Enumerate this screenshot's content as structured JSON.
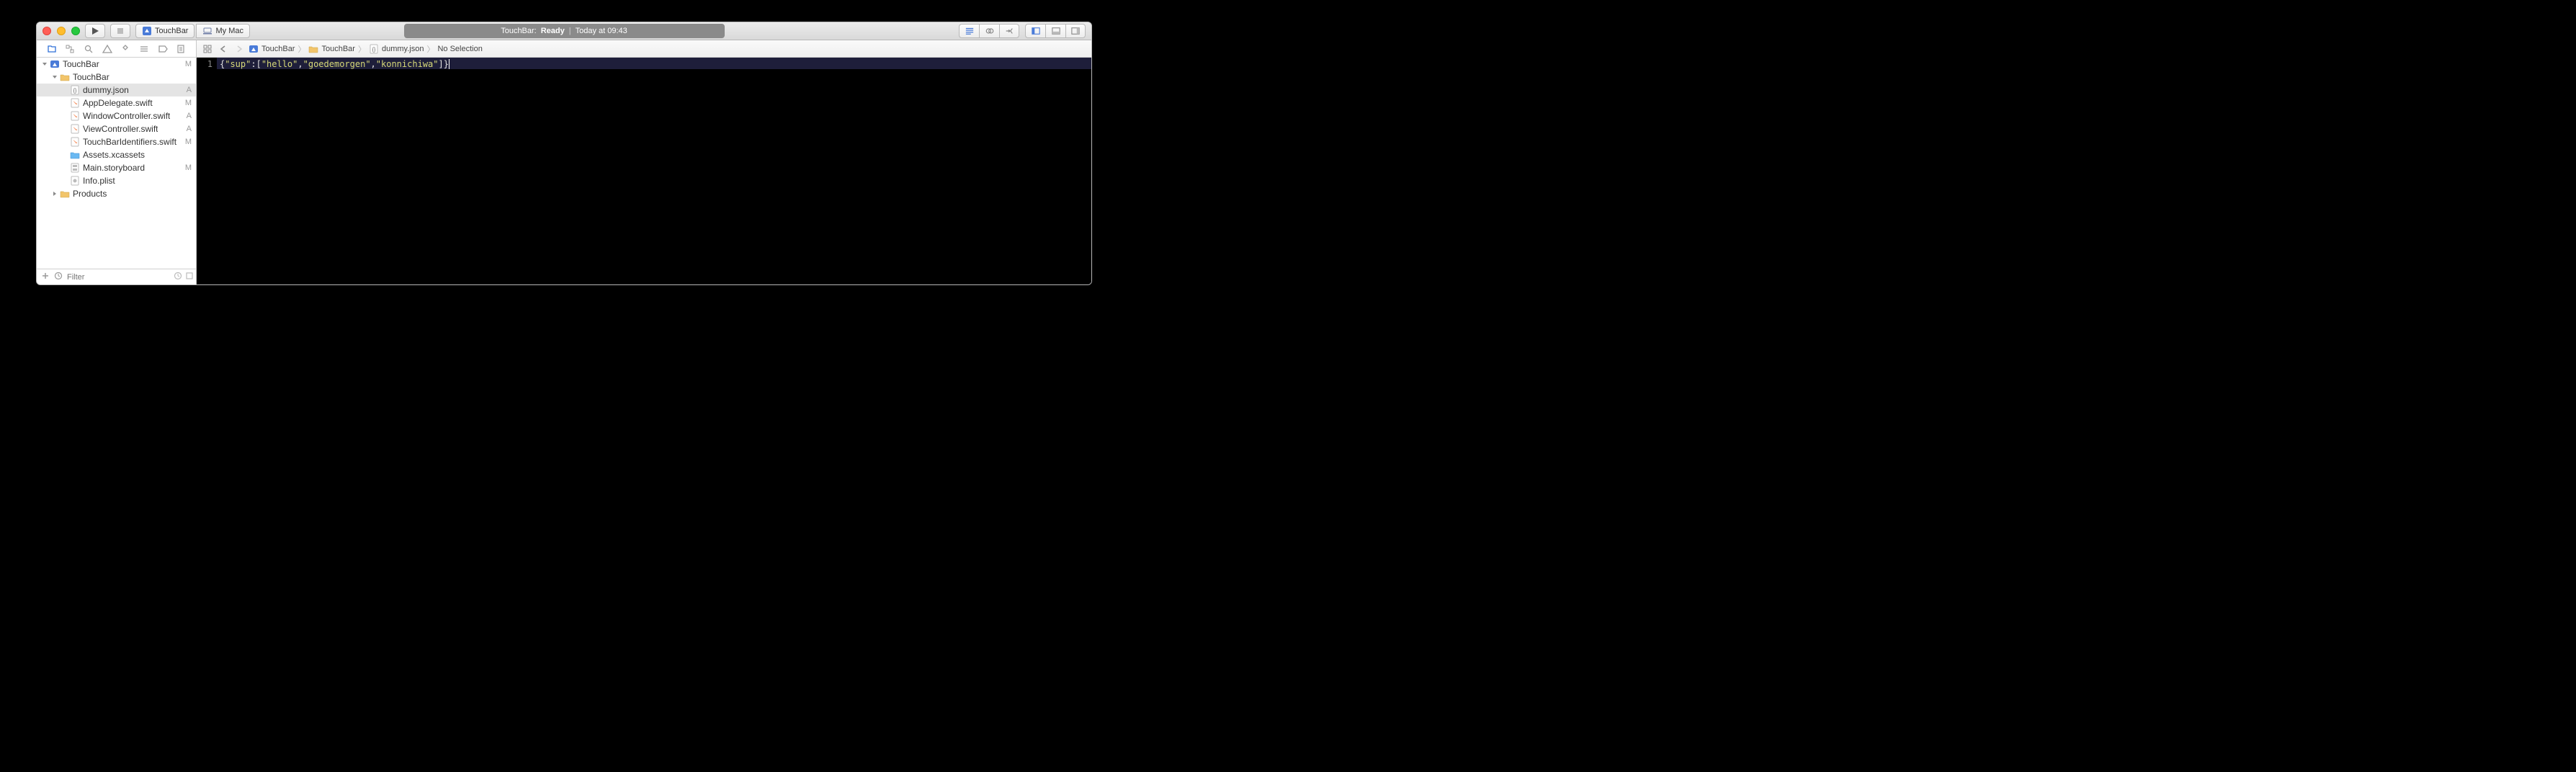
{
  "window": {
    "scheme_target": "TouchBar",
    "scheme_destination": "My Mac",
    "activity_prefix": "TouchBar:",
    "activity_status": "Ready",
    "activity_time": "Today at 09:43"
  },
  "navigator": {
    "filter_placeholder": "Filter",
    "tree": [
      {
        "label": "TouchBar",
        "kind": "proj",
        "depth": 0,
        "disclosure": "open",
        "badge": "M"
      },
      {
        "label": "TouchBar",
        "kind": "folder",
        "depth": 1,
        "disclosure": "open",
        "badge": ""
      },
      {
        "label": "dummy.json",
        "kind": "json",
        "depth": 2,
        "disclosure": "none",
        "badge": "A",
        "selected": true
      },
      {
        "label": "AppDelegate.swift",
        "kind": "swift",
        "depth": 2,
        "disclosure": "none",
        "badge": "M"
      },
      {
        "label": "WindowController.swift",
        "kind": "swift",
        "depth": 2,
        "disclosure": "none",
        "badge": "A"
      },
      {
        "label": "ViewController.swift",
        "kind": "swift",
        "depth": 2,
        "disclosure": "none",
        "badge": "A"
      },
      {
        "label": "TouchBarIdentifiers.swift",
        "kind": "swift",
        "depth": 2,
        "disclosure": "none",
        "badge": "M"
      },
      {
        "label": "Assets.xcassets",
        "kind": "assets",
        "depth": 2,
        "disclosure": "none",
        "badge": ""
      },
      {
        "label": "Main.storyboard",
        "kind": "story",
        "depth": 2,
        "disclosure": "none",
        "badge": "M"
      },
      {
        "label": "Info.plist",
        "kind": "plist",
        "depth": 2,
        "disclosure": "none",
        "badge": ""
      },
      {
        "label": "Products",
        "kind": "folder",
        "depth": 1,
        "disclosure": "closed",
        "badge": ""
      }
    ]
  },
  "jumpbar": {
    "items": [
      {
        "label": "TouchBar",
        "kind": "proj"
      },
      {
        "label": "TouchBar",
        "kind": "folder"
      },
      {
        "label": "dummy.json",
        "kind": "json"
      },
      {
        "label": "No Selection",
        "kind": "none"
      }
    ]
  },
  "editor": {
    "line_numbers": [
      "1"
    ],
    "json_source": {
      "key": "sup",
      "values": [
        "hello",
        "goedemorgen",
        "konnichiwa"
      ]
    }
  }
}
